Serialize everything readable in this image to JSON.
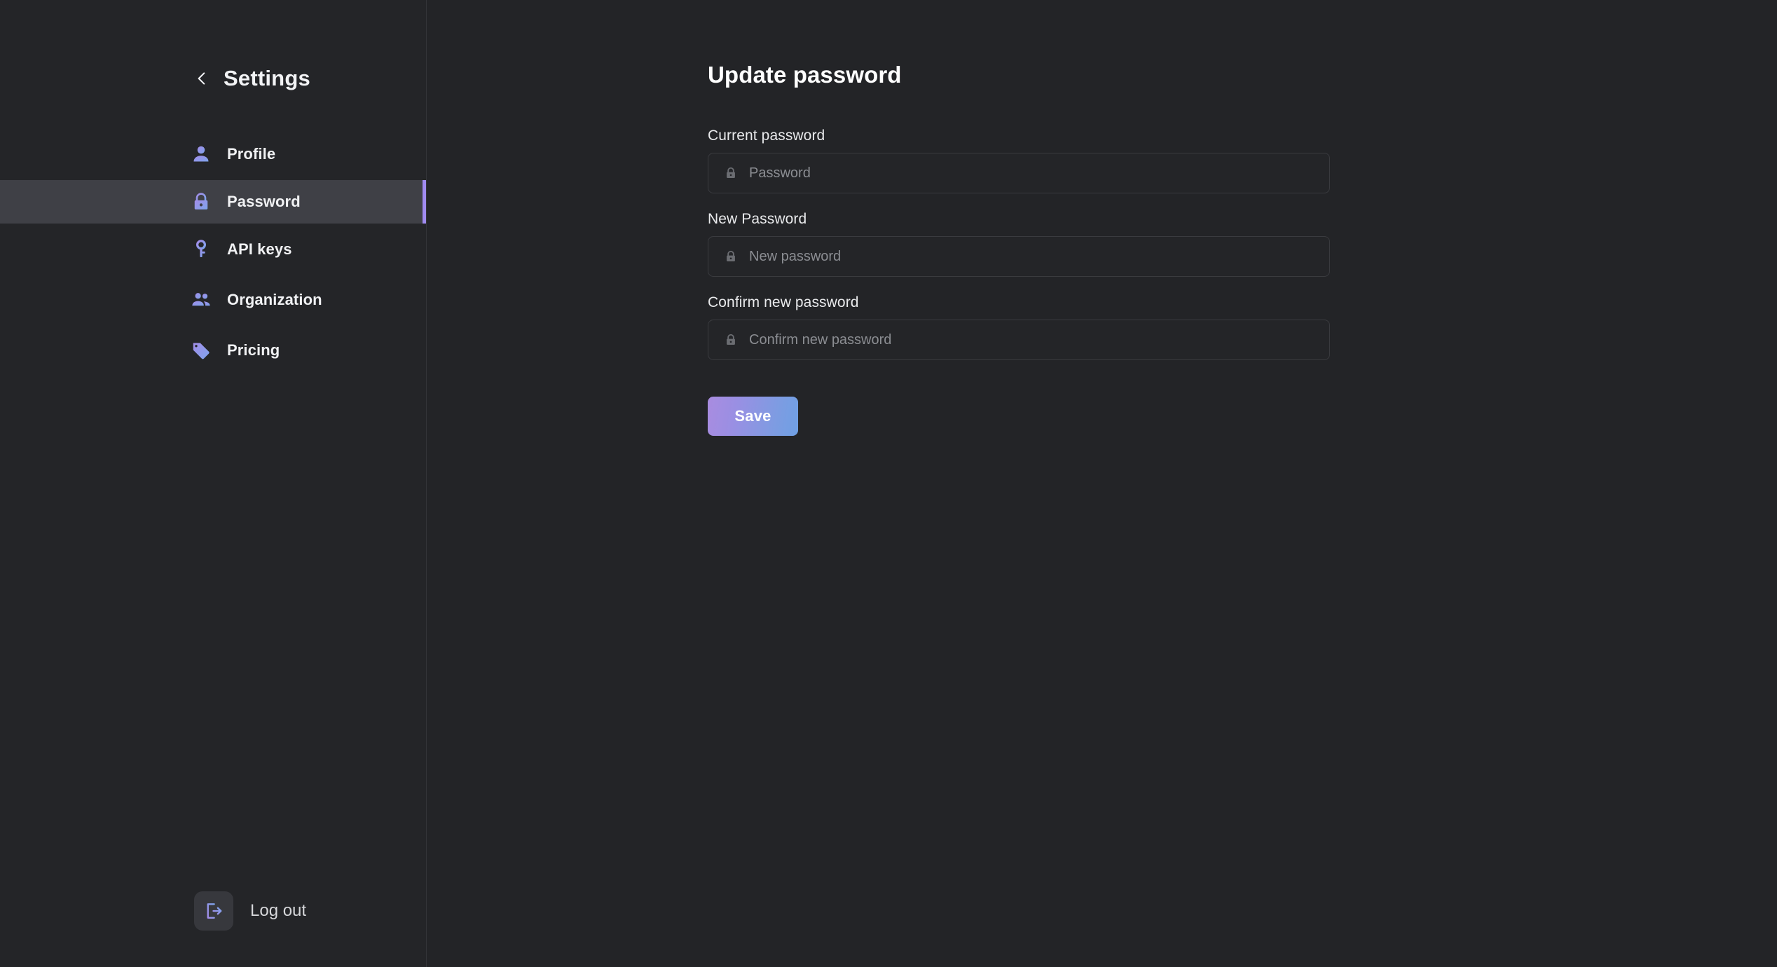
{
  "sidebar": {
    "title": "Settings",
    "back_icon": "chevron-left-icon",
    "items": [
      {
        "label": "Profile",
        "icon": "person-icon",
        "active": false
      },
      {
        "label": "Password",
        "icon": "lock-icon",
        "active": true
      },
      {
        "label": "API keys",
        "icon": "key-icon",
        "active": false
      },
      {
        "label": "Organization",
        "icon": "people-group-icon",
        "active": false
      },
      {
        "label": "Pricing",
        "icon": "tag-icon",
        "active": false
      }
    ],
    "logout": {
      "label": "Log out",
      "icon": "logout-arrow-icon"
    }
  },
  "main": {
    "title": "Update password",
    "fields": [
      {
        "label": "Current password",
        "placeholder": "Password",
        "value": "",
        "icon": "lock-icon"
      },
      {
        "label": "New Password",
        "placeholder": "New password",
        "value": "",
        "icon": "lock-icon"
      },
      {
        "label": "Confirm new password",
        "placeholder": "Confirm new password",
        "value": "",
        "icon": "lock-icon"
      }
    ],
    "save_label": "Save"
  },
  "colors": {
    "background": "#232427",
    "sidebar_background": "#242528",
    "active_item_background": "#3f4046",
    "accent_purple": "#a08bf0",
    "accent_blue": "#6fa0e4",
    "icon_gradient_start": "#a38ce8",
    "icon_gradient_end": "#7ea4ec",
    "text_primary": "#f0f1f3",
    "text_muted": "#8b8d92",
    "input_border": "#3a3b3f"
  }
}
